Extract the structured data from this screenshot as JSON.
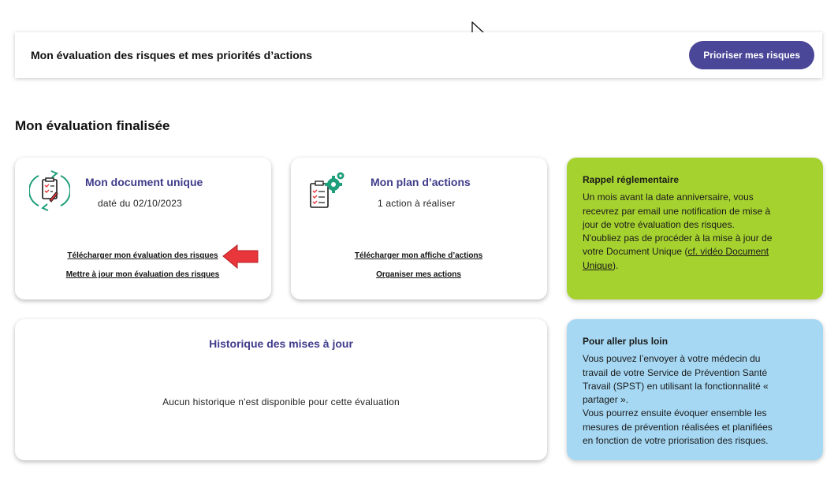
{
  "header": {
    "title": "Mon évaluation des risques et mes priorités d’actions",
    "button_label": "Prioriser mes risques"
  },
  "section": {
    "title": "Mon évaluation finalisée"
  },
  "doc_card": {
    "icon": "document-refresh-icon",
    "title": "Mon document unique",
    "date": "daté du 02/10/2023",
    "link_download": "Télécharger mon évaluation des risques",
    "link_update": "Mettre à jour mon évaluation des risques"
  },
  "plan_card": {
    "icon": "action-plan-gears-icon",
    "title": "Mon plan d’actions",
    "count": "1 action à réaliser",
    "link_download": "Télécharger mon affiche d’actions",
    "link_organize": "Organiser mes actions"
  },
  "history_card": {
    "title": "Historique des mises à jour",
    "empty_text": "Aucun historique n'est disponible pour cette évaluation"
  },
  "reminder_card": {
    "title": "Rappel réglementaire",
    "text_line1": "Un mois avant la date anniversaire, vous",
    "text_line2": "recevrez par email une notification de mise à",
    "text_line3": "jour de votre évaluation des risques.",
    "text_line4": "N'oubliez pas de procéder à la mise à jour de",
    "text_line5_prefix": "votre Document Unique (",
    "link_part1": "cf. vidéo Document",
    "link_part2": "Unique",
    "text_suffix": ").",
    "color": "#a6d22f"
  },
  "further_card": {
    "title": "Pour aller plus loin",
    "lines": [
      "Vous pouvez l’envoyer à votre médecin du",
      "travail de votre Service de Prévention Santé",
      "Travail (SPST) en utilisant la fonctionnalité «",
      "partager ».",
      "Vous pourrez ensuite évoquer ensemble les",
      "mesures de prévention réalisées et planifiées",
      "en fonction de votre priorisation des risques."
    ],
    "color": "#a6d8f3"
  },
  "colors": {
    "accent": "#4a4698",
    "title_purple": "#3f3c8a",
    "icon_green": "#1e9e7a",
    "annotation_red": "#e8363a"
  }
}
